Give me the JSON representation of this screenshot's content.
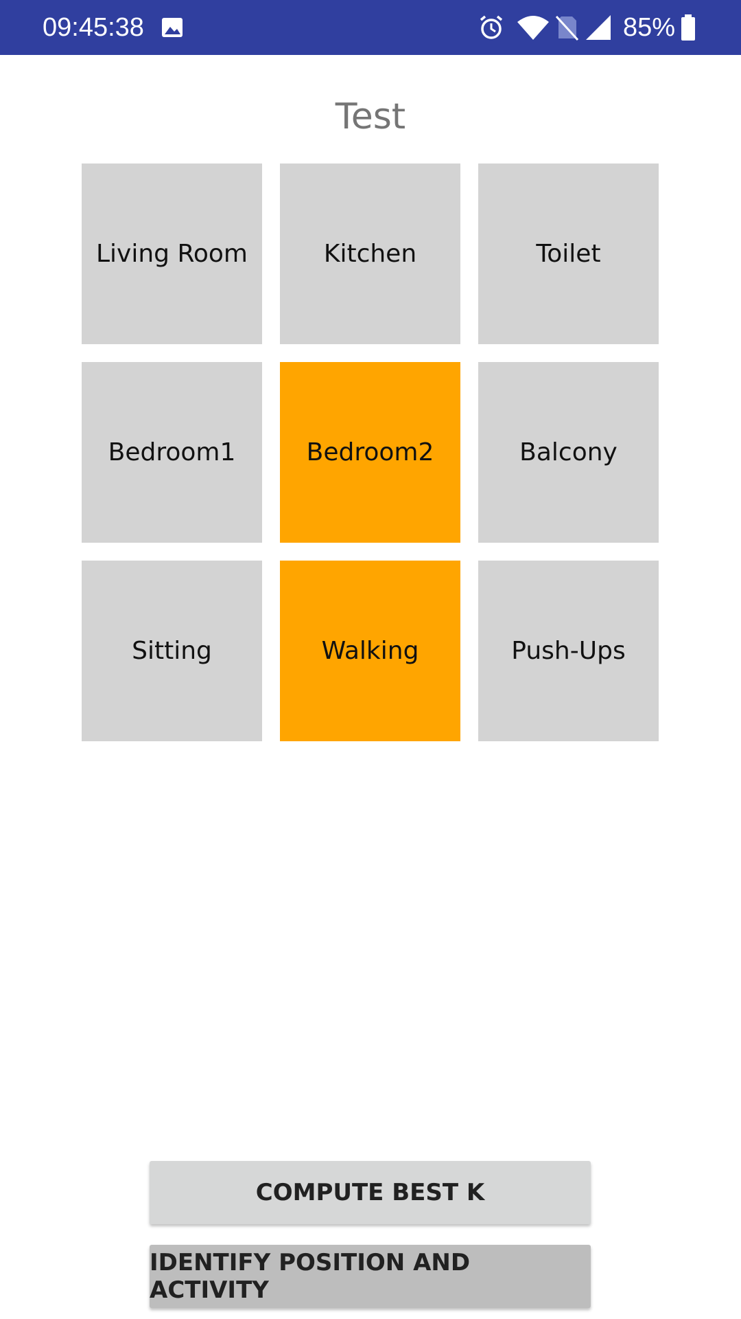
{
  "status_bar": {
    "time": "09:45:38",
    "battery_percent": "85%",
    "icons": [
      "image-icon",
      "alarm-icon",
      "wifi-icon",
      "no-sim-icon",
      "signal-icon",
      "battery-icon"
    ],
    "background": "#303f9f"
  },
  "title": "Test",
  "grid": {
    "tiles": [
      {
        "label": "Living Room",
        "active": false
      },
      {
        "label": "Kitchen",
        "active": false
      },
      {
        "label": "Toilet",
        "active": false
      },
      {
        "label": "Bedroom1",
        "active": false
      },
      {
        "label": "Bedroom2",
        "active": true
      },
      {
        "label": "Balcony",
        "active": false
      },
      {
        "label": "Sitting",
        "active": false
      },
      {
        "label": "Walking",
        "active": true
      },
      {
        "label": "Push-Ups",
        "active": false
      }
    ],
    "colors": {
      "inactive": "#d3d3d3",
      "active": "#ffa500"
    }
  },
  "buttons": {
    "compute": "COMPUTE BEST K",
    "identify": "IDENTIFY POSITION AND ACTIVITY"
  }
}
